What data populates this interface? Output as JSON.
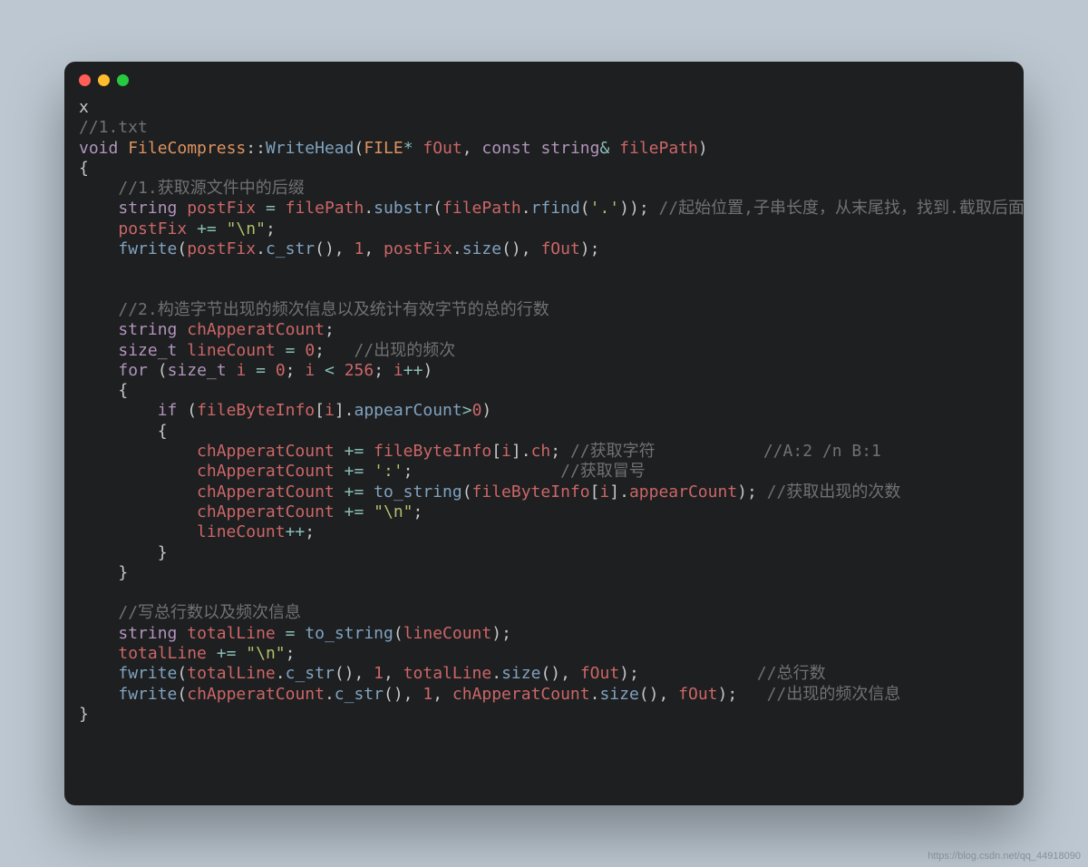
{
  "watermark": "https://blog.csdn.net/qq_44918090",
  "window": {
    "buttons": [
      "close",
      "minimize",
      "zoom"
    ]
  },
  "tokens": {
    "x": "x",
    "c_1txt": "//1.txt",
    "kw_void": "void",
    "cls": "FileCompress",
    "dcolon": "::",
    "fn_wh": "WriteHead",
    "ty_FILE": "FILE",
    "star": "*",
    "v_fOut": "fOut",
    "kw_const": "const",
    "kw_string": "string",
    "amp": "&",
    "v_filePath": "filePath",
    "lbrace": "{",
    "rbrace": "}",
    "c_1": "//1.获取源文件中的后缀",
    "v_postFix": "postFix",
    "eq": "=",
    "dot": ".",
    "fn_substr": "substr",
    "fn_rfind": "rfind",
    "s_dot": "'.'",
    "c_start": "//起始位置,子串长度，从末尾找，找到.截取后面的子串",
    "peq": "+=",
    "s_nl": "\"\\n\"",
    "fn_fwrite": "fwrite",
    "fn_cstr": "c_str",
    "n1": "1",
    "fn_size": "size",
    "c_2": "//2.构造字节出现的频次信息以及统计有效字节的总的行数",
    "v_chApperat": "chApperatCount",
    "kw_size_t": "size_t",
    "v_lineCount": "lineCount",
    "n0": "0",
    "c_freq": "//出现的频次",
    "kw_for": "for",
    "v_i": "i",
    "lt": "<",
    "n256": "256",
    "pp": "++",
    "kw_if": "if",
    "v_fbi": "fileByteInfo",
    "fn_appear": "appearCount",
    "gt": ">",
    "m_ch": "ch",
    "c_getch": "//获取字符",
    "c_ab": "//A:2 /n B:1",
    "s_colon": "':'",
    "c_getcolon": "//获取冒号",
    "fn_tostr": "to_string",
    "c_getcount": "//获取出现的次数",
    "c_3": "//写总行数以及频次信息",
    "v_totalLine": "totalLine",
    "c_total": "//总行数",
    "c_freqinfo": "//出现的频次信息"
  }
}
